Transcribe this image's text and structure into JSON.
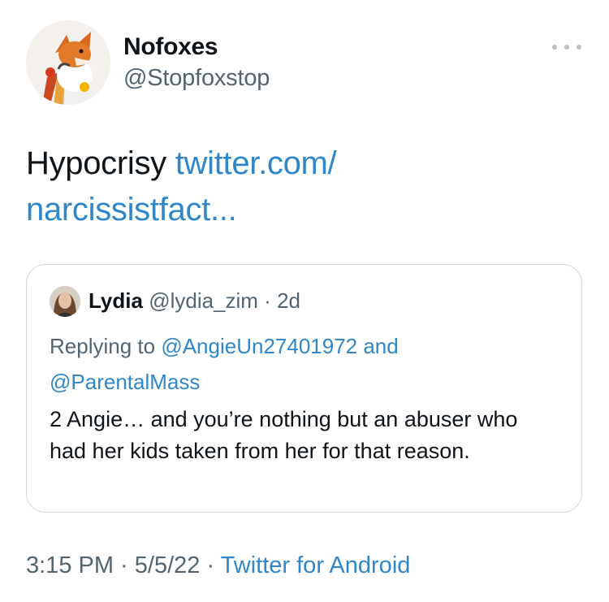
{
  "author": {
    "name": "Nofoxes",
    "handle": "@Stopfoxstop",
    "avatar_icon": "fox-avatar-icon"
  },
  "menu_icon": "more-horizontal-icon",
  "tweet": {
    "text": "Hypocrisy ",
    "link_line1": "twitter.com/",
    "link_line2": "narcissistfact..."
  },
  "quoted": {
    "name": "Lydia",
    "handle": "@lydia_zim",
    "separator": " · ",
    "time": "2d",
    "replying_prefix": "Replying to ",
    "reply_user1": "@AngieUn27401972",
    "reply_and": " and",
    "reply_user2": "@ParentalMass",
    "body": "2 Angie… and you’re nothing but an abuser who had her kids taken from her for that reason."
  },
  "footer": {
    "time": "3:15 PM",
    "sep1": " · ",
    "date": "5/5/22",
    "sep2": " · ",
    "source": "Twitter for Android"
  },
  "colors": {
    "link": "#2f87c9",
    "secondary_text": "#536471",
    "border": "#cfd9de"
  }
}
